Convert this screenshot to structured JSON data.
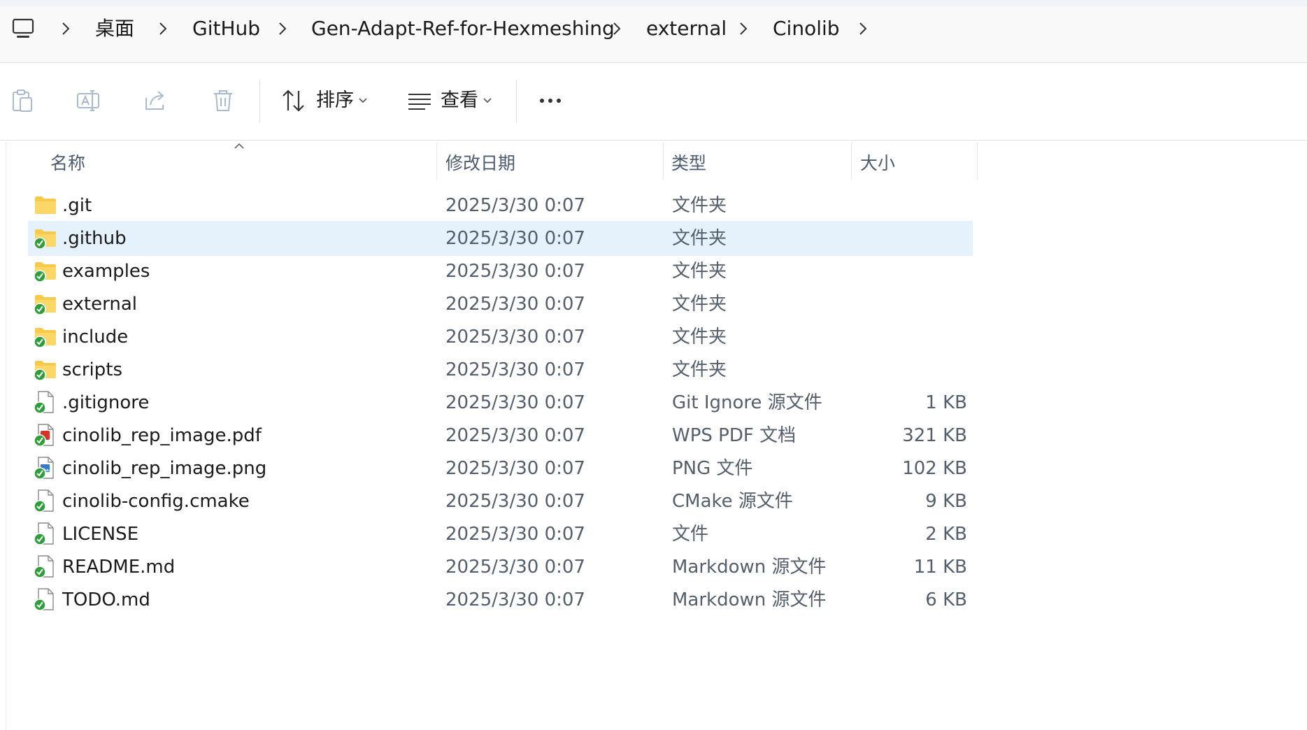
{
  "breadcrumb": {
    "root_icon": "computer-icon",
    "items": [
      "桌面",
      "GitHub",
      "Gen-Adapt-Ref-for-Hexmeshing",
      "external",
      "Cinolib"
    ]
  },
  "toolbar": {
    "icons": [
      "paste-icon",
      "rename-icon",
      "share-icon",
      "delete-icon"
    ],
    "sort_label": "排序",
    "view_label": "查看",
    "more_icon": "more-icon"
  },
  "columns": {
    "name": "名称",
    "modified": "修改日期",
    "type": "类型",
    "size": "大小"
  },
  "files": [
    {
      "name": ".git",
      "date": "2025/3/30 0:07",
      "type": "文件夹",
      "size": "",
      "icon": "folder-icon",
      "synced": false,
      "selected": false
    },
    {
      "name": ".github",
      "date": "2025/3/30 0:07",
      "type": "文件夹",
      "size": "",
      "icon": "folder-icon",
      "synced": true,
      "selected": true
    },
    {
      "name": "examples",
      "date": "2025/3/30 0:07",
      "type": "文件夹",
      "size": "",
      "icon": "folder-icon",
      "synced": true,
      "selected": false
    },
    {
      "name": "external",
      "date": "2025/3/30 0:07",
      "type": "文件夹",
      "size": "",
      "icon": "folder-icon",
      "synced": true,
      "selected": false
    },
    {
      "name": "include",
      "date": "2025/3/30 0:07",
      "type": "文件夹",
      "size": "",
      "icon": "folder-icon",
      "synced": true,
      "selected": false
    },
    {
      "name": "scripts",
      "date": "2025/3/30 0:07",
      "type": "文件夹",
      "size": "",
      "icon": "folder-icon",
      "synced": true,
      "selected": false
    },
    {
      "name": ".gitignore",
      "date": "2025/3/30 0:07",
      "type": "Git Ignore 源文件",
      "size": "1 KB",
      "icon": "file-icon",
      "synced": true,
      "selected": false
    },
    {
      "name": "cinolib_rep_image.pdf",
      "date": "2025/3/30 0:07",
      "type": "WPS PDF 文档",
      "size": "321 KB",
      "icon": "pdf-file-icon",
      "synced": true,
      "selected": false
    },
    {
      "name": "cinolib_rep_image.png",
      "date": "2025/3/30 0:07",
      "type": "PNG 文件",
      "size": "102 KB",
      "icon": "image-file-icon",
      "synced": true,
      "selected": false
    },
    {
      "name": "cinolib-config.cmake",
      "date": "2025/3/30 0:07",
      "type": "CMake 源文件",
      "size": "9 KB",
      "icon": "file-icon",
      "synced": true,
      "selected": false
    },
    {
      "name": "LICENSE",
      "date": "2025/3/30 0:07",
      "type": "文件",
      "size": "2 KB",
      "icon": "file-icon",
      "synced": true,
      "selected": false
    },
    {
      "name": "README.md",
      "date": "2025/3/30 0:07",
      "type": "Markdown 源文件",
      "size": "11 KB",
      "icon": "file-icon",
      "synced": true,
      "selected": false
    },
    {
      "name": "TODO.md",
      "date": "2025/3/30 0:07",
      "type": "Markdown 源文件",
      "size": "6 KB",
      "icon": "file-icon",
      "synced": true,
      "selected": false
    }
  ],
  "colors": {
    "selection": "#e5f1fb",
    "folder": "#f8c94a",
    "sync_green": "#2e9e3a",
    "pdf_red": "#d9342b",
    "png_blue": "#3a78c9"
  }
}
